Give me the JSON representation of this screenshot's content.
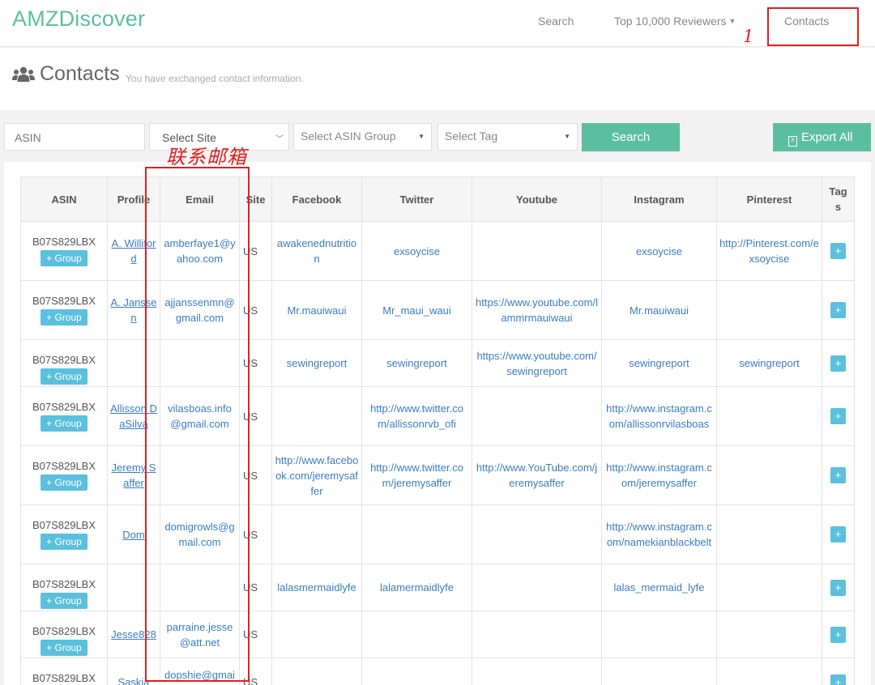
{
  "app": {
    "brand": "AMZDiscover",
    "nav": {
      "search": "Search",
      "reviewers": "Top 10,000 Reviewers",
      "contacts": "Contacts"
    }
  },
  "annotations": {
    "step_number": "1",
    "email_label": "联系邮箱"
  },
  "header": {
    "title": "Contacts",
    "subtitle": "You have exchanged contact information."
  },
  "filters": {
    "asin_placeholder": "ASIN",
    "site_selected": "Select Site",
    "asin_group_placeholder": "Select ASIN Group",
    "tag_placeholder": "Select Tag",
    "search_button": "Search",
    "export_button": "Export All"
  },
  "table": {
    "headers": {
      "asin": "ASIN",
      "profile": "Profile",
      "email": "Email",
      "site": "Site",
      "facebook": "Facebook",
      "twitter": "Twitter",
      "youtube": "Youtube",
      "instagram": "Instagram",
      "pinterest": "Pinterest",
      "tags": "Tags"
    },
    "group_button": "+ Group",
    "tag_button": "+",
    "rows": [
      {
        "asin": "B07S829LBX",
        "profile": "A. Williford",
        "email": "amberfaye1@yahoo.com",
        "site": "US",
        "facebook": "awakenednutrition",
        "twitter": "exsoycise",
        "youtube": "",
        "instagram": "exsoycise",
        "pinterest": "http://Pinterest.com/exsoycise"
      },
      {
        "asin": "B07S829LBX",
        "profile": "A. Janssen",
        "email": "ajjanssenmn@gmail.com",
        "site": "US",
        "facebook": "Mr.mauiwaui",
        "twitter": "Mr_maui_waui",
        "youtube": "https://www.youtube.com/lammrmauiwaui",
        "instagram": "Mr.mauiwaui",
        "pinterest": ""
      },
      {
        "asin": "B07S829LBX",
        "profile": "",
        "email": "",
        "site": "US",
        "facebook": "sewingreport",
        "twitter": "sewingreport",
        "youtube": "https://www.youtube.com/sewingreport",
        "instagram": "sewingreport",
        "pinterest": "sewingreport"
      },
      {
        "asin": "B07S829LBX",
        "profile": "Allisson DaSilva",
        "email": "vilasboas.info@gmail.com",
        "site": "US",
        "facebook": "",
        "twitter": "http://www.twitter.com/allissonrvb_ofi",
        "youtube": "",
        "instagram": "http://www.instagram.com/allissonrvilasboas",
        "pinterest": ""
      },
      {
        "asin": "B07S829LBX",
        "profile": "Jeremy Saffer",
        "email": "",
        "site": "US",
        "facebook": "http://www.facebook.com/jeremysaffer",
        "twitter": "http://www.twitter.com/jeremysaffer",
        "youtube": "http://www.YouTube.com/jeremysaffer",
        "instagram": "http://www.instagram.com/jeremysaffer",
        "pinterest": ""
      },
      {
        "asin": "B07S829LBX",
        "profile": "Dom",
        "email": "domigrowls@gmail.com",
        "site": "US",
        "facebook": "",
        "twitter": "",
        "youtube": "",
        "instagram": "http://www.instagram.com/namekianblackbelt",
        "pinterest": ""
      },
      {
        "asin": "B07S829LBX",
        "profile": "",
        "email": "",
        "site": "US",
        "facebook": "lalasmermaidlyfe",
        "twitter": "lalamermaidlyfe",
        "youtube": "",
        "instagram": "lalas_mermaid_lyfe",
        "pinterest": ""
      },
      {
        "asin": "B07S829LBX",
        "profile": "Jesse828",
        "email": "parraine.jesse@att.net",
        "site": "US",
        "facebook": "",
        "twitter": "",
        "youtube": "",
        "instagram": "",
        "pinterest": ""
      },
      {
        "asin": "B07S829LBX",
        "profile": "Saskia",
        "email": "dopshie@gmail.com",
        "site": "US",
        "facebook": "",
        "twitter": "",
        "youtube": "",
        "instagram": "",
        "pinterest": ""
      }
    ]
  },
  "colors": {
    "brand": "#5bbf9f",
    "info_button": "#5bc0de",
    "link": "#3a7cc3",
    "annotation": "#e02020"
  }
}
